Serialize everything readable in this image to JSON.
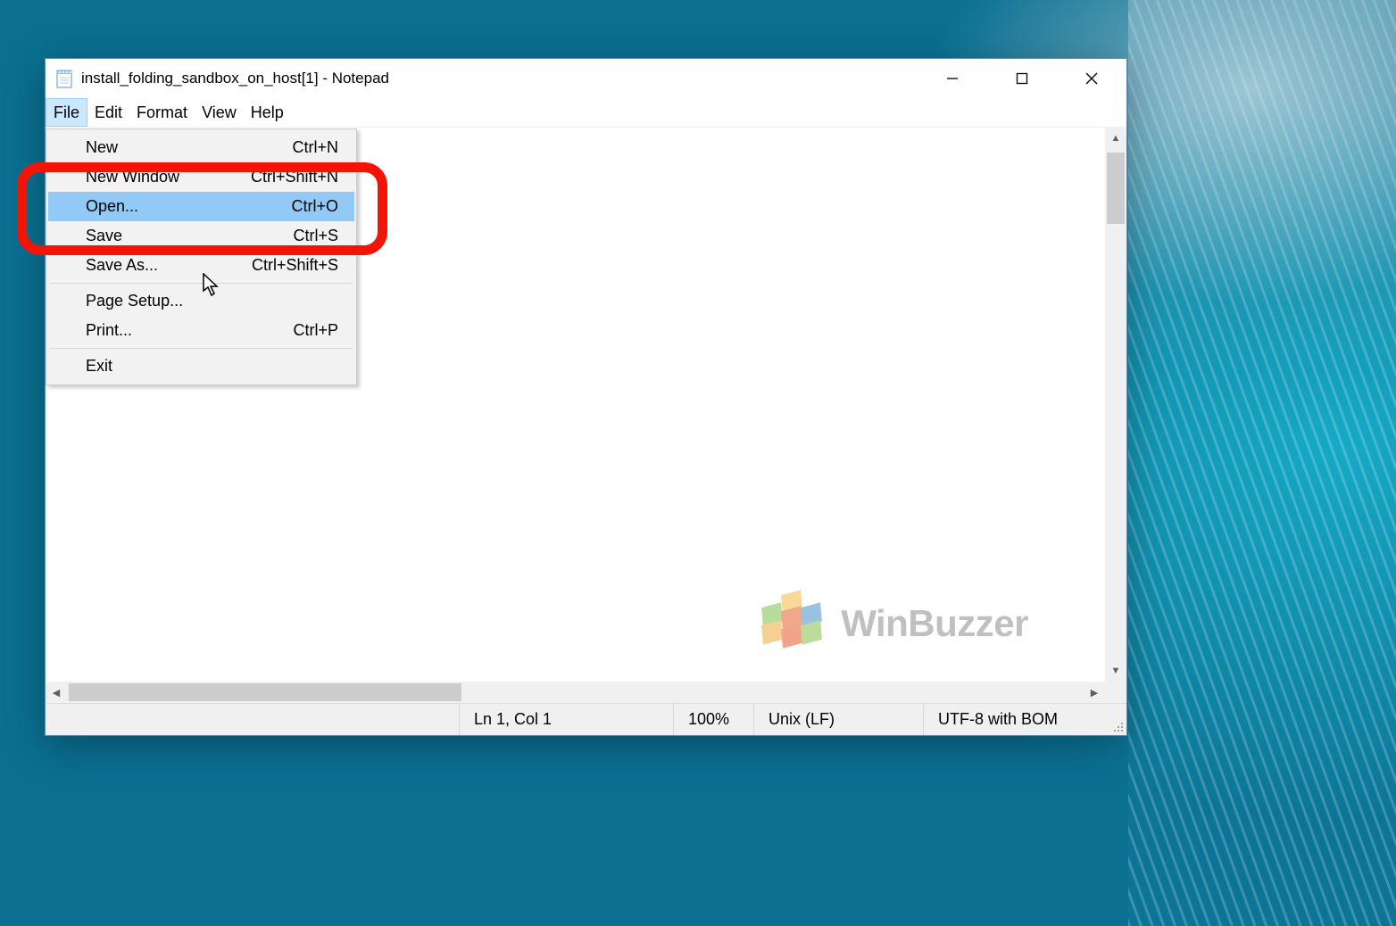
{
  "window": {
    "title": "install_folding_sandbox_on_host[1] - Notepad"
  },
  "menubar": {
    "items": [
      "File",
      "Edit",
      "Format",
      "View",
      "Help"
    ],
    "active_index": 0
  },
  "file_menu": {
    "items": [
      {
        "label": "New",
        "shortcut": "Ctrl+N"
      },
      {
        "label": "New Window",
        "shortcut": "Ctrl+Shift+N"
      },
      {
        "label": "Open...",
        "shortcut": "Ctrl+O",
        "highlighted": true
      },
      {
        "label": "Save",
        "shortcut": "Ctrl+S"
      },
      {
        "label": "Save As...",
        "shortcut": "Ctrl+Shift+S"
      },
      {
        "separator": true
      },
      {
        "label": "Page Setup...",
        "shortcut": ""
      },
      {
        "label": "Print...",
        "shortcut": "Ctrl+P"
      },
      {
        "separator": true
      },
      {
        "label": "Exit",
        "shortcut": ""
      }
    ]
  },
  "statusbar": {
    "position": "Ln 1, Col 1",
    "zoom": "100%",
    "line_ending": "Unix (LF)",
    "encoding": "UTF-8 with BOM"
  },
  "watermark": {
    "text": "WinBuzzer"
  }
}
